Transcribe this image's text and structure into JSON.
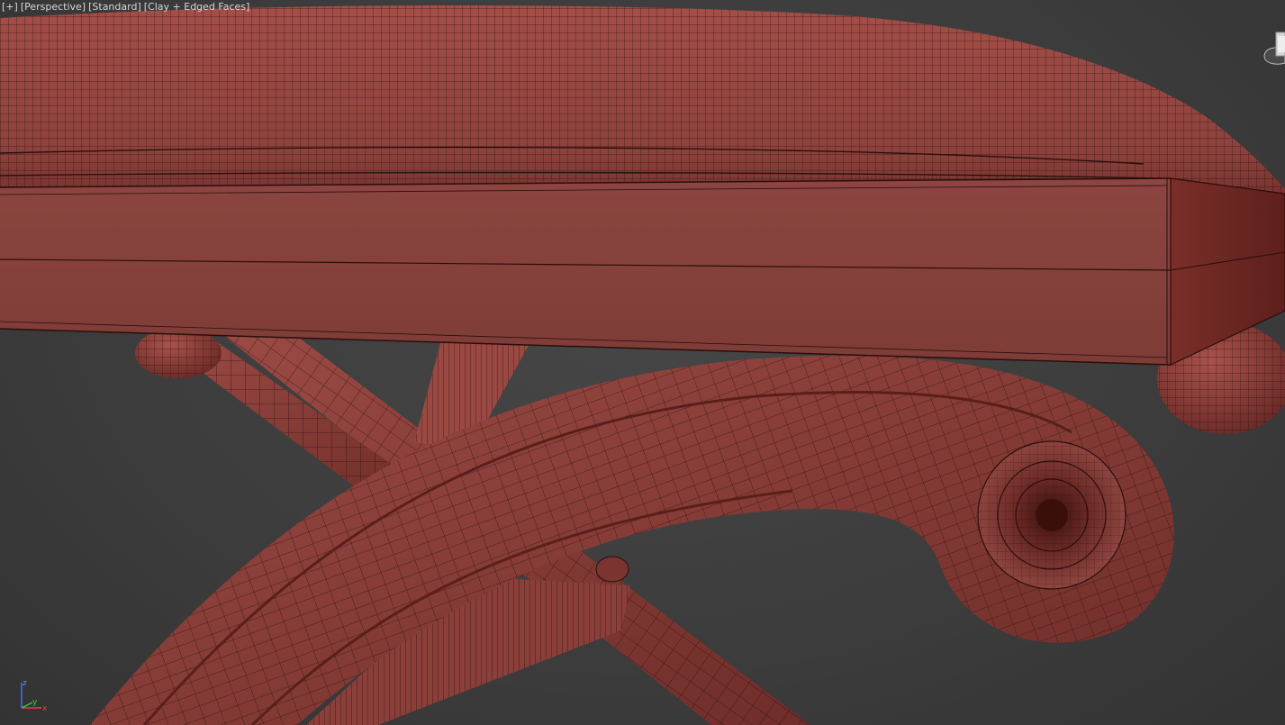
{
  "viewport": {
    "labels": [
      {
        "text": "[+]",
        "name": "viewport-menu-plus"
      },
      {
        "text": "[Perspective]",
        "name": "viewport-pov-menu"
      },
      {
        "text": "[Standard]",
        "name": "viewport-shading-quality-menu"
      },
      {
        "text": "[Clay + Edged Faces]",
        "name": "viewport-shading-mode-menu"
      }
    ],
    "axis": {
      "x": "x",
      "y": "y",
      "z": "z"
    }
  },
  "colors": {
    "background": "#3f3f3f",
    "model_base": "#8e4540",
    "model_light": "#a9524c",
    "model_dark": "#6a2a26",
    "wire": "#2a0e0c",
    "axis_x": "#e04040",
    "axis_y": "#40c040",
    "axis_z": "#4070ff"
  },
  "icons": {
    "viewcube": "viewcube-icon",
    "axis": "axis-tripod-icon"
  }
}
